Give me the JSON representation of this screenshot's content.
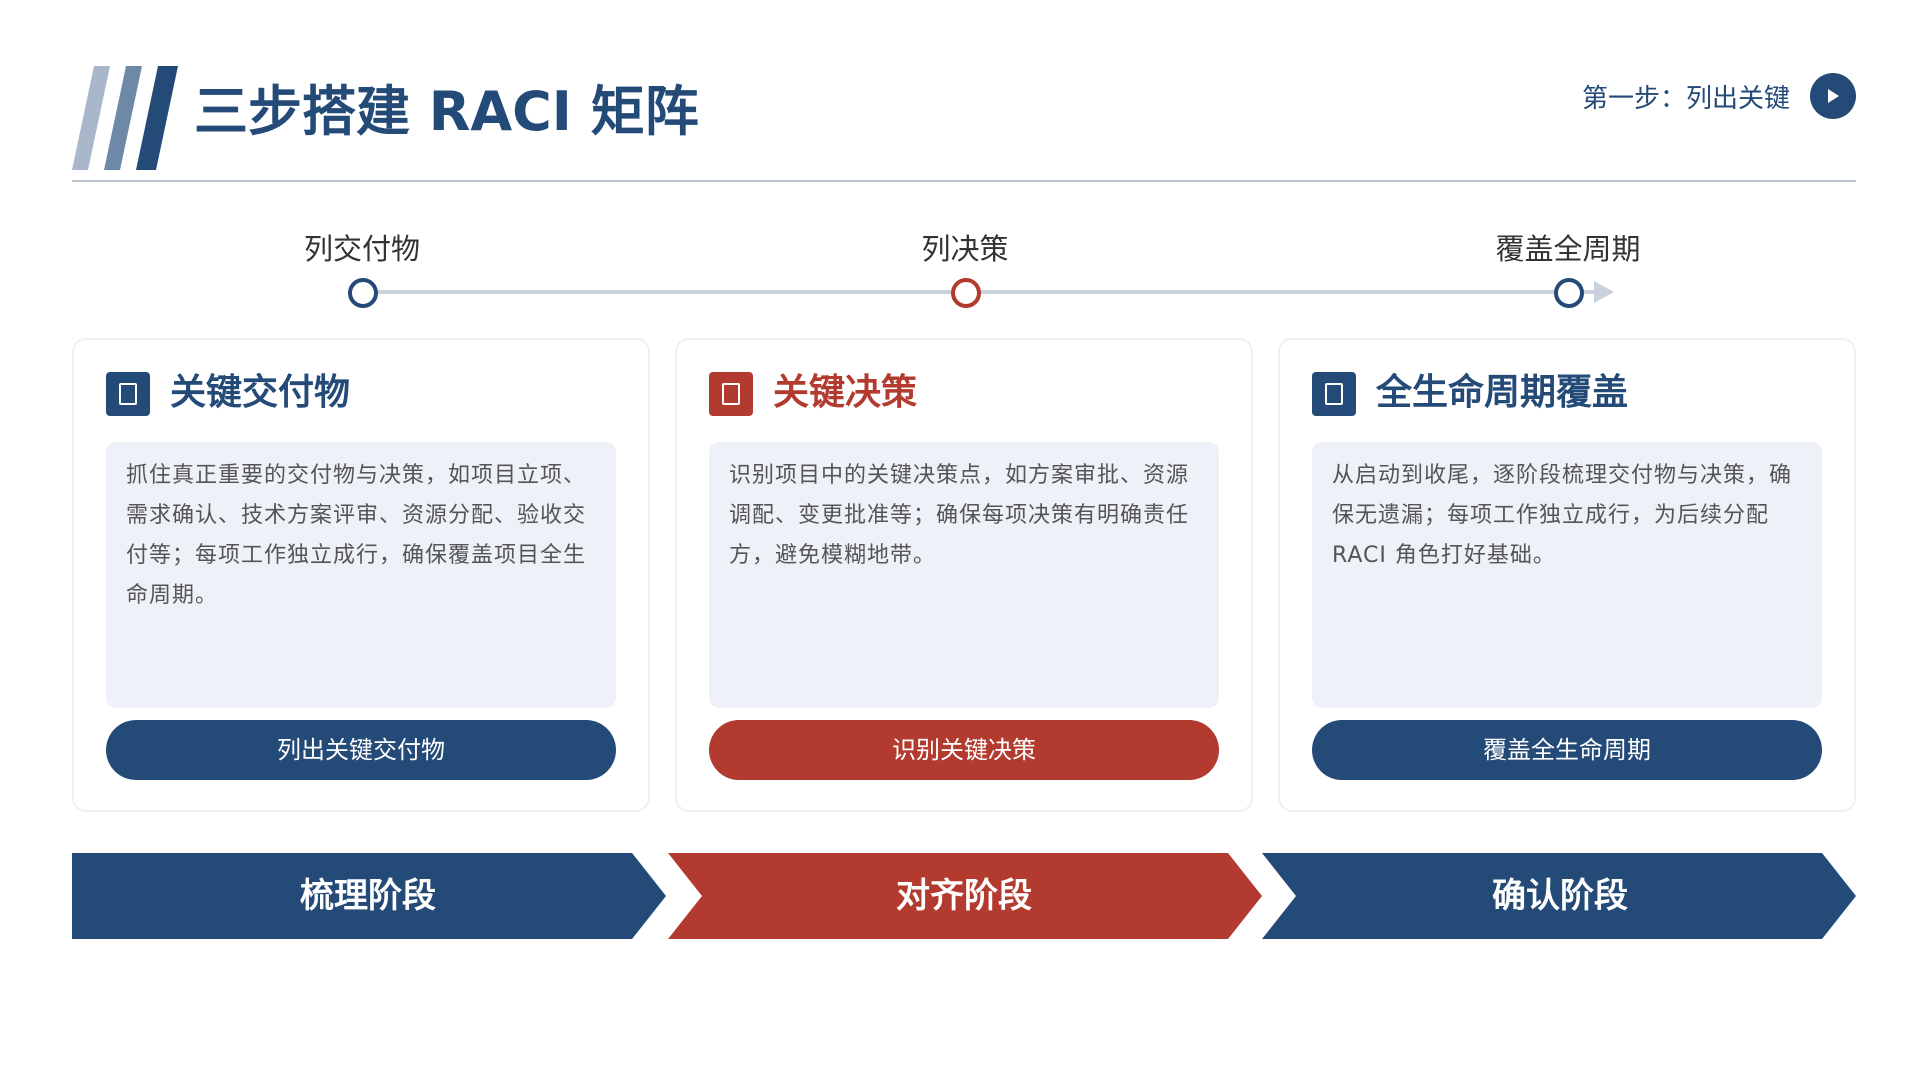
{
  "header": {
    "title": "三步搭建 RACI 矩阵",
    "step_indicator": "第一步：列出关键"
  },
  "timeline": {
    "nodes": [
      {
        "label": "列交付物",
        "color": "#244a78"
      },
      {
        "label": "列决策",
        "color": "#b23a2e"
      },
      {
        "label": "覆盖全周期",
        "color": "#244a78"
      }
    ]
  },
  "cards": [
    {
      "title": "关键交付物",
      "body": "抓住真正重要的交付物与决策，如项目立项、需求确认、技术方案评审、资源分配、验收交付等；每项工作独立成行，确保覆盖项目全生命周期。",
      "button": "列出关键交付物",
      "accent": "#244a78"
    },
    {
      "title": "关键决策",
      "body": "识别项目中的关键决策点，如方案审批、资源调配、变更批准等；确保每项决策有明确责任方，避免模糊地带。",
      "button": "识别关键决策",
      "accent": "#b23a2e"
    },
    {
      "title": "全生命周期覆盖",
      "body": "从启动到收尾，逐阶段梳理交付物与决策，确保无遗漏；每项工作独立成行，为后续分配 RACI 角色打好基础。",
      "button": "覆盖全生命周期",
      "accent": "#244a78"
    }
  ],
  "phases": [
    {
      "label": "梳理阶段",
      "color": "#244a78"
    },
    {
      "label": "对齐阶段",
      "color": "#b23a2e"
    },
    {
      "label": "确认阶段",
      "color": "#244a78"
    }
  ],
  "colors": {
    "primary": "#244a78",
    "accent": "#b23a2e",
    "panel": "#eef2f8"
  }
}
